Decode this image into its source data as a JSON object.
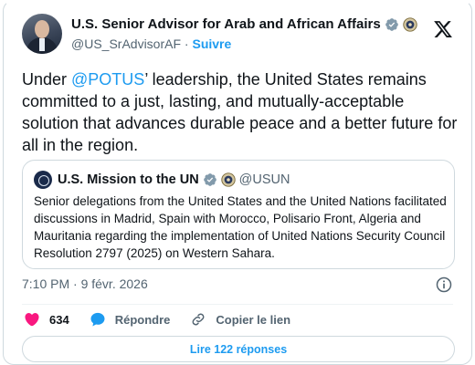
{
  "author": {
    "display_name": "U.S. Senior Advisor for Arab and African Affairs",
    "handle": "@US_SrAdvisorAF",
    "separator": "·",
    "follow_label": "Suivre",
    "verified_badge": "government-gray-check",
    "affiliate_badge": "seal-icon"
  },
  "tweet": {
    "text_before": "Under ",
    "mention": "@POTUS",
    "text_after": "’ leadership, the United States remains committed to a just, lasting, and mutually-acceptable solution that advances durable peace and a better future for all in the region."
  },
  "quote": {
    "name": "U.S. Mission to the UN",
    "handle": "@USUN",
    "text": "Senior delegations from the United States and the United Nations facilitated discussions in Madrid, Spain with Morocco, Polisario Front, Algeria and Mauritania regarding the implementation of United Nations Security Council Resolution 2797 (2025) on Western Sahara."
  },
  "meta": {
    "timestamp": "7:10 PM · 9 févr. 2026"
  },
  "actions": {
    "like_count": "634",
    "reply_label": "Répondre",
    "copy_link_label": "Copier le lien"
  },
  "replies_button": "Lire 122 réponses",
  "colors": {
    "accent": "#1d9bf0",
    "like": "#f91880",
    "text": "#0f1419",
    "muted": "#536471",
    "border": "#cfd9de"
  }
}
